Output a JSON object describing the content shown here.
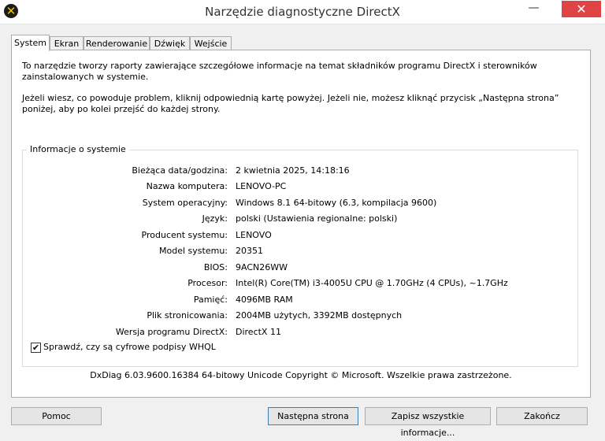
{
  "window": {
    "title": "Narzędzie diagnostyczne DirectX",
    "minimize_glyph": "—",
    "close_glyph": "✕"
  },
  "tabs": [
    {
      "label": "System",
      "active": true
    },
    {
      "label": "Ekran",
      "active": false
    },
    {
      "label": "Renderowanie",
      "active": false
    },
    {
      "label": "Dźwięk",
      "active": false
    },
    {
      "label": "Wejście",
      "active": false
    }
  ],
  "intro": {
    "p1": "To narzędzie tworzy raporty zawierające szczegółowe informacje na temat składników programu DirectX i sterowników zainstalowanych w systemie.",
    "p2": "Jeżeli wiesz, co powoduje problem, kliknij odpowiednią kartę powyżej. Jeżeli nie, możesz kliknąć przycisk „Następna strona” poniżej, aby po kolei przejść do każdej strony."
  },
  "system_info": {
    "group_title": "Informacje o systemie",
    "rows": [
      {
        "label": "Bieżąca data/godzina:",
        "value": "2 kwietnia 2025, 14:18:16"
      },
      {
        "label": "Nazwa komputera:",
        "value": "LENOVO-PC"
      },
      {
        "label": "System operacyjny:",
        "value": "Windows 8.1 64-bitowy (6.3, kompilacja 9600)"
      },
      {
        "label": "Język:",
        "value": "polski (Ustawienia regionalne: polski)"
      },
      {
        "label": "Producent systemu:",
        "value": "LENOVO"
      },
      {
        "label": "Model systemu:",
        "value": "20351"
      },
      {
        "label": "BIOS:",
        "value": "9ACN26WW"
      },
      {
        "label": "Procesor:",
        "value": "Intel(R) Core(TM) i3-4005U CPU @ 1.70GHz (4 CPUs), ~1.7GHz"
      },
      {
        "label": "Pamięć:",
        "value": "4096MB RAM"
      },
      {
        "label": "Plik stronicowania:",
        "value": "2004MB użytych, 3392MB dostępnych"
      },
      {
        "label": "Wersja programu DirectX:",
        "value": "DirectX 11"
      }
    ]
  },
  "whql_checkbox": {
    "label": "Sprawdź, czy są cyfrowe podpisy WHQL",
    "checked": true,
    "mark": "✔"
  },
  "footer_text": "DxDiag 6.03.9600.16384 64-bitowy Unicode  Copyright © Microsoft. Wszelkie prawa zastrzeżone.",
  "buttons": {
    "help": "Pomoc",
    "next": "Następna strona",
    "save": "Zapisz wszystkie informacje...",
    "exit": "Zakończ"
  }
}
